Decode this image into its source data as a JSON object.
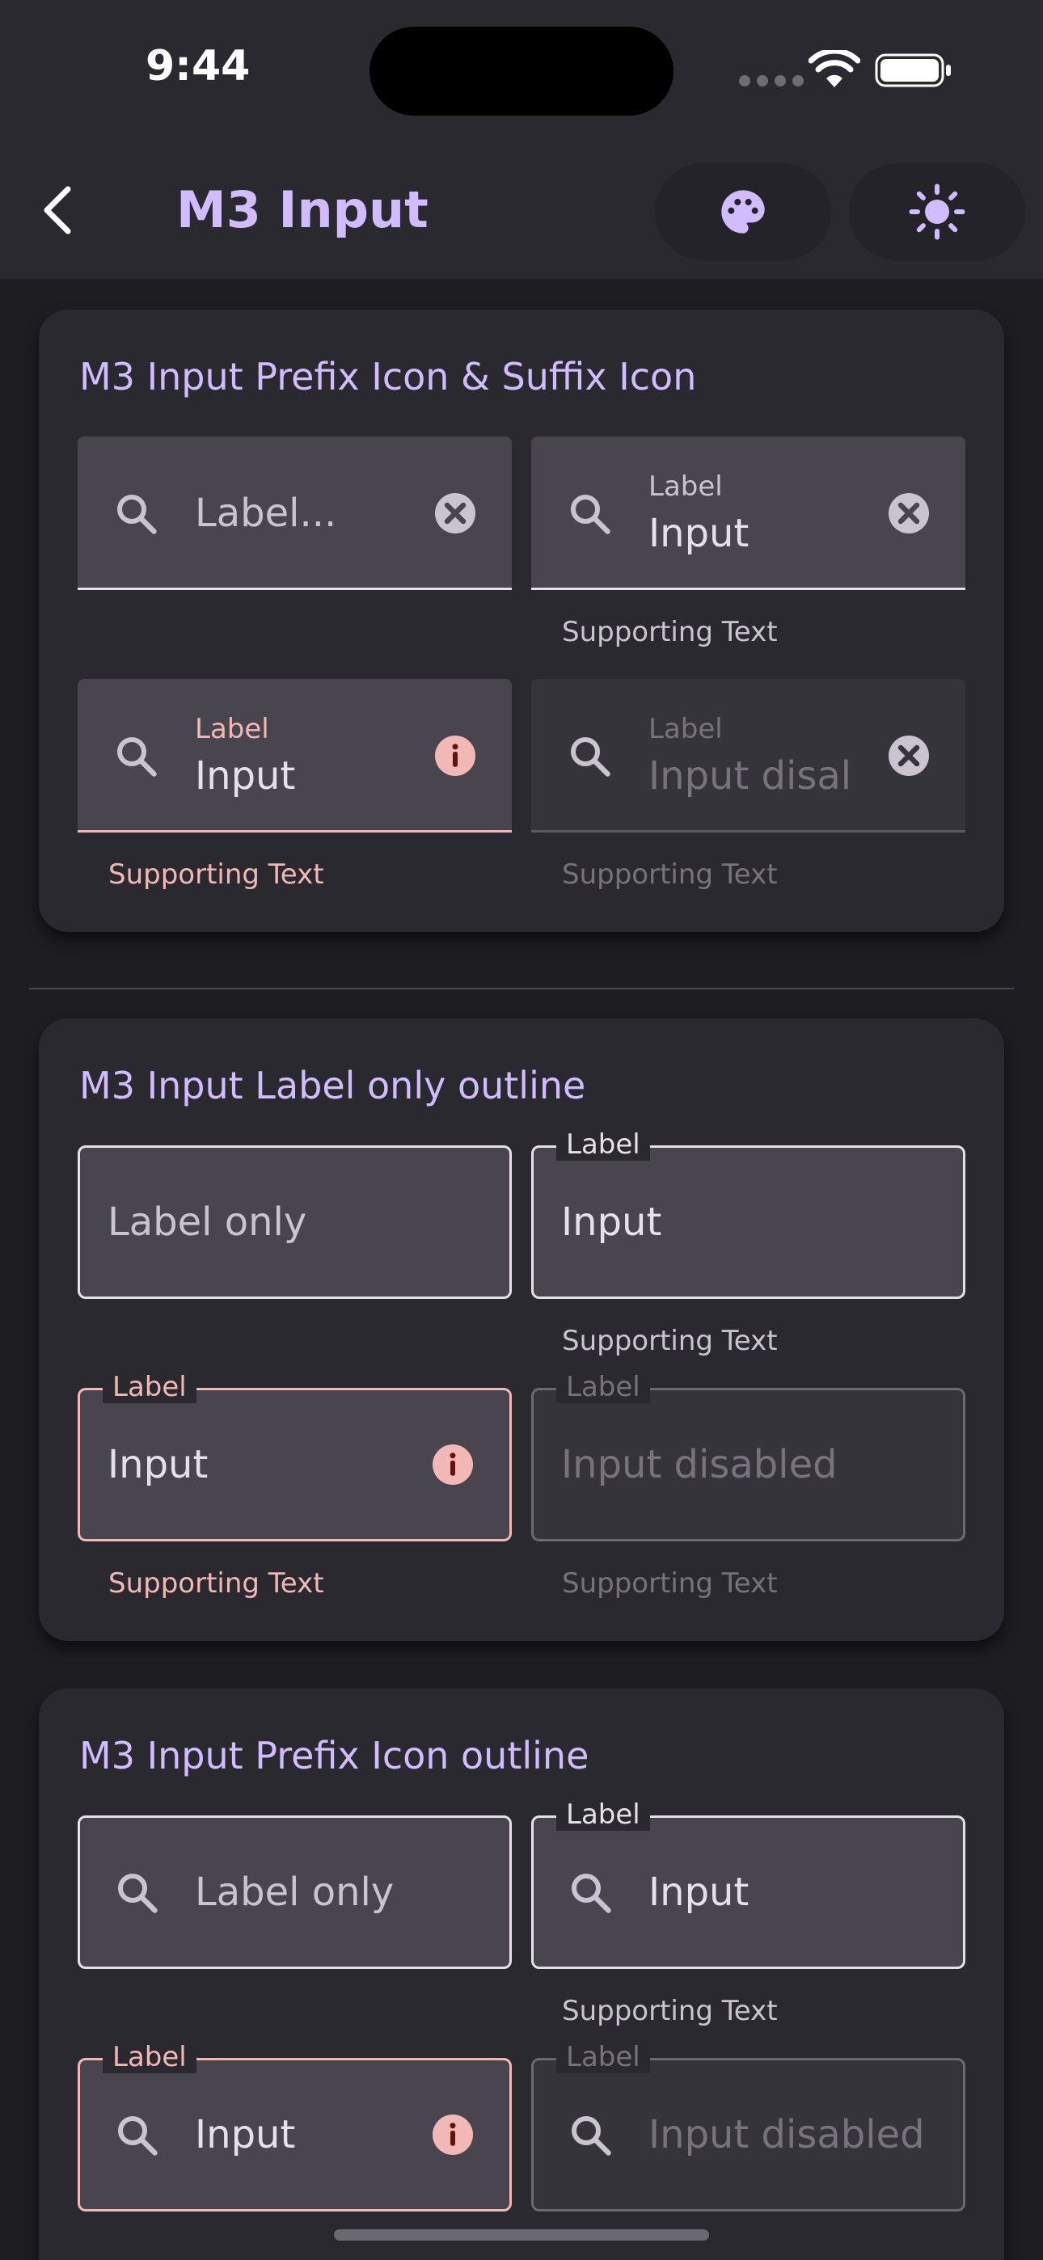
{
  "status_bar": {
    "time": "9:44"
  },
  "app_bar": {
    "title": "M3 Input",
    "back_icon": "chevron-left-icon",
    "actions": [
      "palette-icon",
      "sun-icon"
    ]
  },
  "colors": {
    "accent": "#d0bcff",
    "surface": "#2b2930",
    "field_fill": "#49454f",
    "error": "#f2b8b5"
  },
  "sections": [
    {
      "title": "M3 Input Prefix Icon & Suffix Icon",
      "fields": [
        {
          "hint": "Label...",
          "prefix": "search-icon",
          "suffix": "clear-icon"
        },
        {
          "label": "Label",
          "value": "Input",
          "support": "Supporting Text",
          "prefix": "search-icon",
          "suffix": "clear-icon"
        },
        {
          "label": "Label",
          "value": "Input",
          "support": "Supporting Text",
          "prefix": "search-icon",
          "suffix": "info-icon",
          "state": "error"
        },
        {
          "label": "Label",
          "value": "Input disal",
          "support": "Supporting Text",
          "prefix": "search-icon",
          "suffix": "clear-icon",
          "state": "disabled"
        }
      ]
    },
    {
      "title": "M3 Input Label only outline",
      "fields": [
        {
          "hint": "Label only"
        },
        {
          "label": "Label",
          "value": "Input",
          "support": "Supporting Text"
        },
        {
          "label": "Label",
          "value": "Input",
          "support": "Supporting Text",
          "suffix": "info-icon",
          "state": "error"
        },
        {
          "label": "Label",
          "value": "Input disabled",
          "support": "Supporting Text",
          "state": "disabled"
        }
      ]
    },
    {
      "title": "M3 Input Prefix Icon outline",
      "fields": [
        {
          "hint": "Label only",
          "prefix": "search-icon"
        },
        {
          "label": "Label",
          "value": "Input",
          "support": "Supporting Text",
          "prefix": "search-icon"
        },
        {
          "label": "Label",
          "value": "Input",
          "prefix": "search-icon",
          "suffix": "info-icon",
          "state": "error"
        },
        {
          "label": "Label",
          "value": "Input disabled",
          "prefix": "search-icon",
          "state": "disabled"
        }
      ]
    }
  ]
}
